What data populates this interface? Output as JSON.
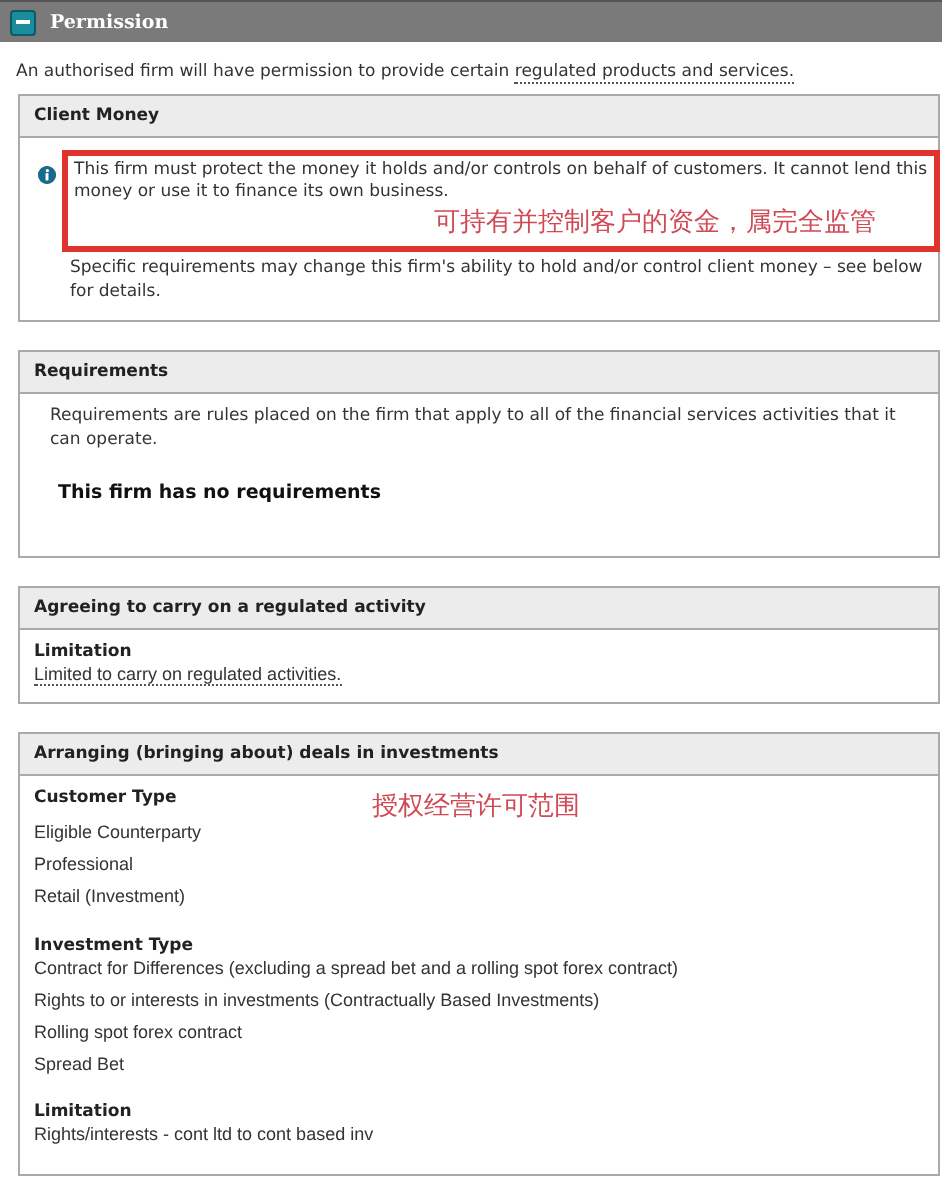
{
  "header": {
    "title": "Permission",
    "expanded": true
  },
  "intro": {
    "text": "An authorised firm will have permission to provide certain ",
    "link": "regulated products and services."
  },
  "sections": [
    {
      "kind": "notice",
      "title": "Client Money",
      "highlight": "This firm must protect the money it holds and/or controls on behalf of customers. It cannot lend this money or use it to finance its own business.",
      "annotation": "可持有并控制客户的资金，属完全监管",
      "note": "Specific requirements may change this firm's ability to hold and/or control client money – see below for details."
    },
    {
      "kind": "requirements",
      "title": "Requirements",
      "description": "Requirements are rules placed on the firm that apply to all of the financial services activities that it can operate.",
      "statement": "This firm has no requirements"
    },
    {
      "kind": "groups",
      "title": "Agreeing to carry on a regulated activity",
      "groups": [
        {
          "heading": "Limitation",
          "items": [
            {
              "text": "Limited to carry on regulated activities.",
              "link": true
            }
          ]
        }
      ]
    },
    {
      "kind": "groups",
      "title": "Arranging (bringing about) deals in investments",
      "annotation": "授权经营许可范围",
      "groups": [
        {
          "heading": "Customer Type",
          "items": [
            {
              "text": "Eligible Counterparty",
              "link": false
            },
            {
              "text": "Professional",
              "link": false
            },
            {
              "text": "Retail (Investment)",
              "link": false
            }
          ]
        },
        {
          "heading": "Investment Type",
          "items": [
            {
              "text": "Contract for Differences (excluding a spread bet and a rolling spot forex contract)",
              "link": false
            },
            {
              "text": "Rights to or interests in investments (Contractually Based Investments)",
              "link": false
            },
            {
              "text": "Rolling spot forex contract",
              "link": false
            },
            {
              "text": "Spread Bet",
              "link": false
            }
          ]
        },
        {
          "heading": "Limitation",
          "items": [
            {
              "text": "Rights/interests - cont ltd to cont based inv",
              "link": false
            }
          ]
        }
      ]
    }
  ]
}
